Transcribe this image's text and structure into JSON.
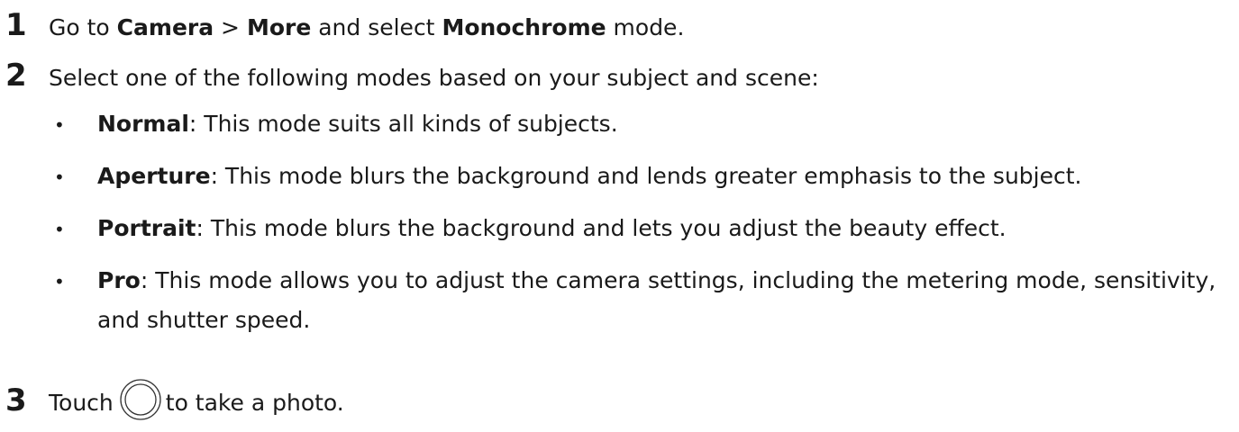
{
  "steps": [
    {
      "num": "1",
      "pre": "Go to ",
      "b1": "Camera",
      "sep": " > ",
      "b2": "More",
      "mid": " and select ",
      "b3": "Monochrome",
      "post": " mode."
    },
    {
      "num": "2",
      "text": "Select one of the following modes based on your subject and scene:"
    },
    {
      "num": "3",
      "pre": "Touch",
      "icon": "shutter-button-icon",
      "post": "to take a photo."
    }
  ],
  "modes": [
    {
      "bullet": "•",
      "name": "Normal",
      "desc": ": This mode suits all kinds of subjects."
    },
    {
      "bullet": "•",
      "name": "Aperture",
      "desc": ": This mode blurs the background and lends greater emphasis to the subject."
    },
    {
      "bullet": "•",
      "name": "Portrait",
      "desc": ": This mode blurs the background and lets you adjust the beauty effect."
    },
    {
      "bullet": "•",
      "name": "Pro",
      "desc": ": This mode allows you to adjust the camera settings, including the metering mode, sensitivity, and shutter speed."
    }
  ]
}
